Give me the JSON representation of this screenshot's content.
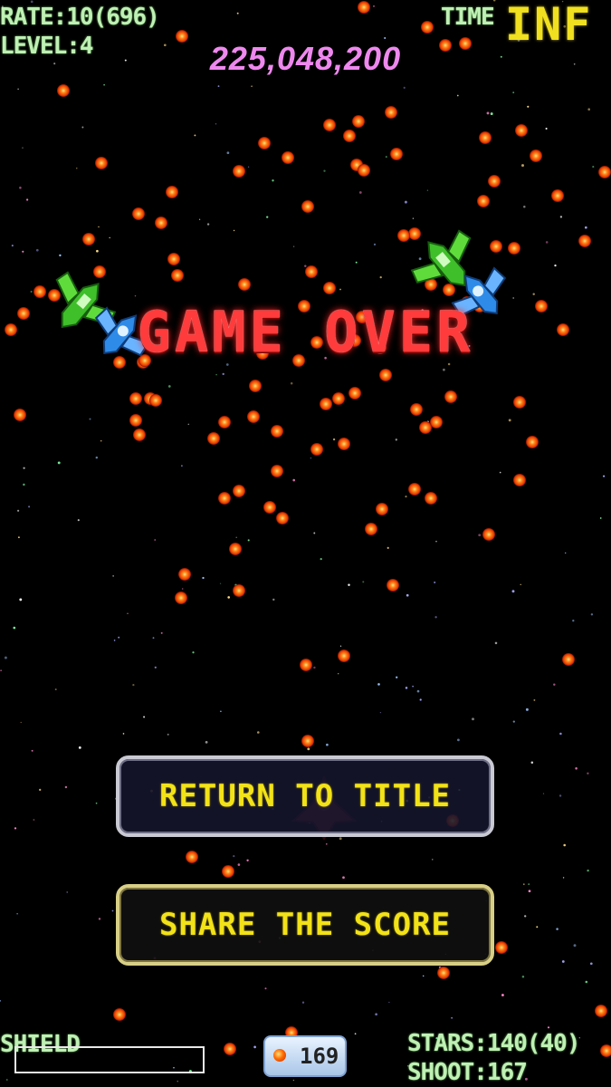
{
  "hud": {
    "rate": "RATE:10(696)",
    "level": "LEVEL:4",
    "time_label": "TIME",
    "time_value": "INF",
    "score": "225,048,200",
    "shield_label": "SHIELD",
    "stars": "STARS:140(40)",
    "shoot": "SHOOT:167",
    "bomb_count": "169"
  },
  "title": {
    "text": "GAME OVER"
  },
  "buttons": {
    "return": "RETURN TO TITLE",
    "share": "SHARE THE SCORE"
  },
  "colors": {
    "hud_text": "#bff0b4",
    "time_value": "#f0e020",
    "score": "#ee88ee",
    "game_over": "#ff3b3b",
    "button_text": "#f2e218",
    "bullet": "#ff6a00"
  },
  "icons": [
    "bomb-icon",
    "green-enemy-ship",
    "blue-enemy-ship",
    "player-ship"
  ]
}
